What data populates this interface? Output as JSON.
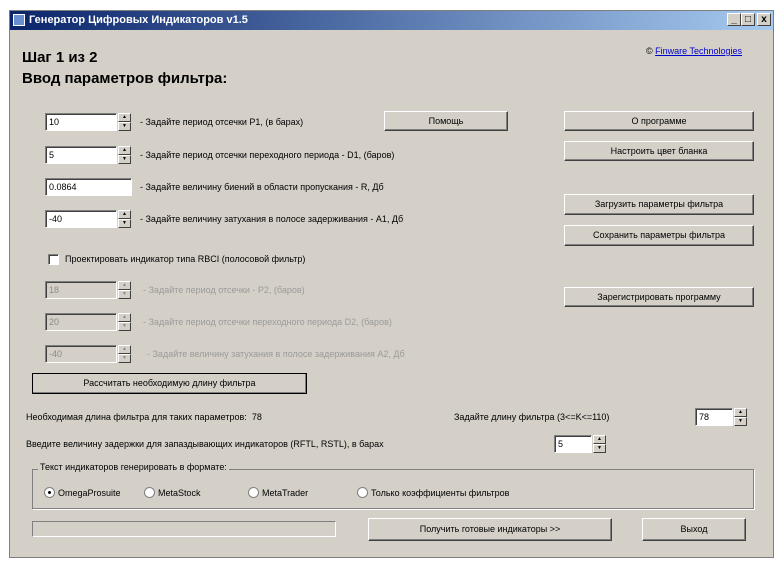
{
  "window": {
    "title": "Генератор Цифровых Индикаторов v1.5",
    "minimize": "_",
    "maximize": "□",
    "close": "x"
  },
  "header": {
    "step": "Шаг 1 из 2",
    "heading": "Ввод параметров фильтра:",
    "copyright_symbol": "©",
    "copyright_link": "Finware Technologies"
  },
  "params": {
    "p1": {
      "value": "10",
      "label": "- Задайте период отсечки P1, (в барах)"
    },
    "d1": {
      "value": "5",
      "label": "- Задайте период отсечки переходного периода - D1, (баров)"
    },
    "r": {
      "value": "0.0864",
      "label": "- Задайте величину биений в области пропускания - R, Дб"
    },
    "a1": {
      "value": "-40",
      "label": "- Задайте величину затухания в полосе задерживания - A1, Дб"
    }
  },
  "rbci": {
    "checkbox_label": "Проектировать индикатор типа RBCI (полосовой фильтр)",
    "p2": {
      "value": "18",
      "label": "- Задайте период отсечки - P2, (баров)"
    },
    "d2": {
      "value": "20",
      "label": "- Задайте период отсечки переходного периода D2, (баров)"
    },
    "a2": {
      "value": "-40",
      "label": "- Задайте величину затухания в полосе задерживания A2, Дб"
    }
  },
  "buttons": {
    "help": "Помощь",
    "about": "О программе",
    "color": "Настроить цвет бланка",
    "load": "Загрузить параметры фильтра",
    "save": "Сохранить параметры фильтра",
    "register": "Зарегистрировать программу",
    "calc": "Рассчитать необходимую длину фильтра",
    "get": "Получить готовые индикаторы >>",
    "exit": "Выход"
  },
  "result": {
    "length_label": "Необходимая длина фильтра для таких параметров:",
    "length_value": "78",
    "set_length_label": "Задайте длину фильтра (3<=K<=110)",
    "set_length_value": "78",
    "delay_label": "Введите величину задержки для запаздывающих индикаторов (RFTL, RSTL), в барах",
    "delay_value": "5"
  },
  "format": {
    "group_title": "Текст индикаторов генерировать в формате:",
    "options": [
      "OmegaProsuite",
      "MetaStock",
      "MetaTrader",
      "Только коэффициенты фильтров"
    ],
    "selected": "OmegaProsuite"
  },
  "progress": {
    "value": 0
  },
  "colors": {
    "face": "#d4d0c8",
    "title_start": "#0a246a",
    "title_end": "#a6caf0",
    "link": "#0000cc"
  }
}
